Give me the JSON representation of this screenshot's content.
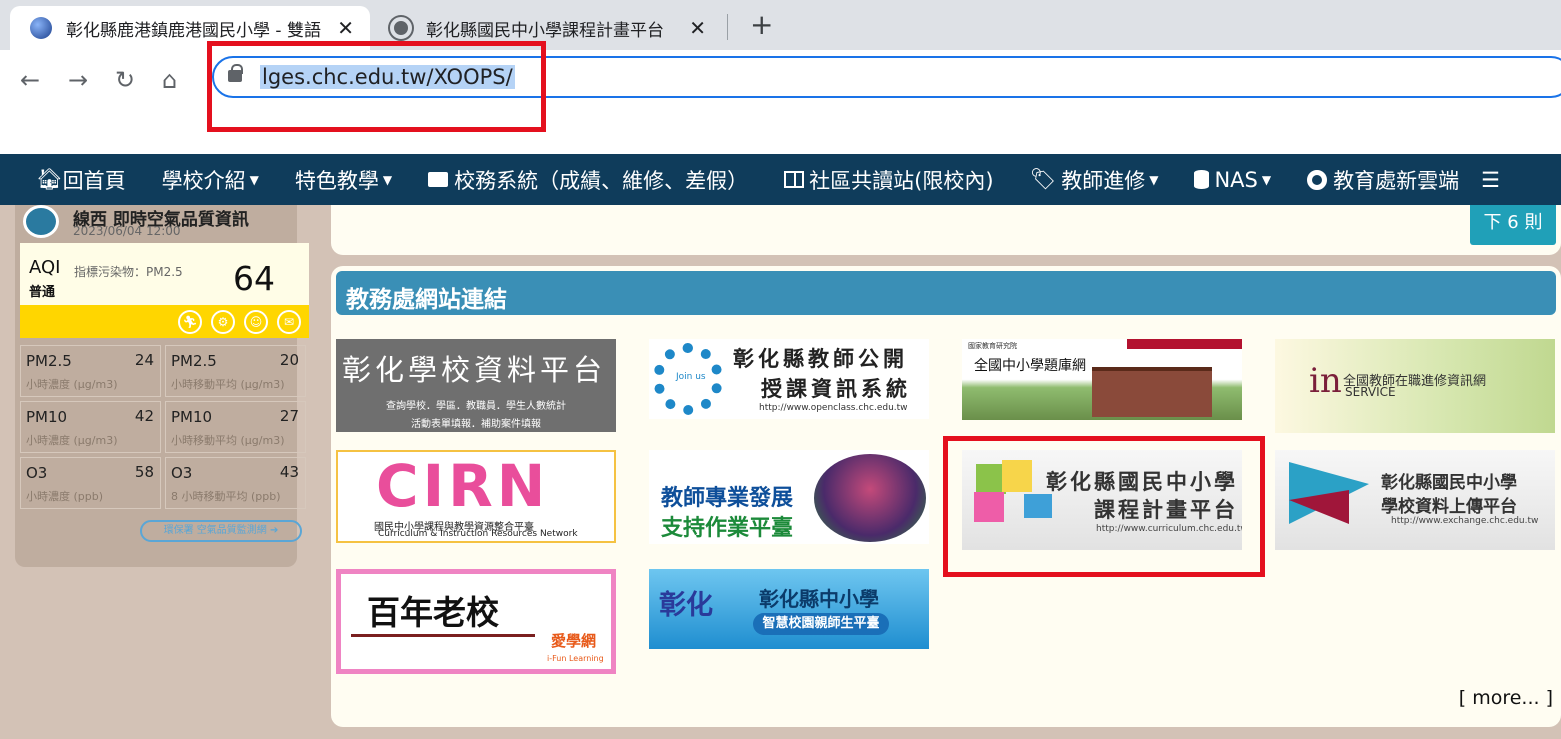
{
  "browser": {
    "tabs": [
      {
        "title": "彰化縣鹿港鎮鹿港國民小學 - 雙語",
        "close": "✕"
      },
      {
        "title": "彰化縣國民中小學課程計畫平台",
        "close": "✕"
      }
    ],
    "new_tab": "+",
    "url": "lges.chc.edu.tw/XOOPS/"
  },
  "nav": {
    "items": [
      {
        "icon": "home-icon",
        "label": "回首頁",
        "caret": false
      },
      {
        "icon": "",
        "label": "學校介紹",
        "caret": true
      },
      {
        "icon": "",
        "label": "特色教學",
        "caret": true
      },
      {
        "icon": "briefcase-icon",
        "label": "校務系統（成績、維修、差假）",
        "caret": false
      },
      {
        "icon": "columns-icon",
        "label": "社區共讀站(限校內)",
        "caret": false
      },
      {
        "icon": "tags-icon",
        "label": "教師進修",
        "caret": true
      },
      {
        "icon": "database-icon",
        "label": "NAS",
        "caret": true
      },
      {
        "icon": "lifebuoy-icon",
        "label": "教育處新雲端",
        "caret": false
      }
    ]
  },
  "air": {
    "title": "線西 即時空氣品質資訊",
    "date": "2023/06/04 12:00",
    "aqi_label": "AQI",
    "status": "普通",
    "pollutant": "指標污染物：PM2.5",
    "aqi_value": "64",
    "cells": [
      {
        "name": "PM2.5",
        "value": "24",
        "sub": "小時濃度 (μg/m3)"
      },
      {
        "name": "PM2.5",
        "value": "20",
        "sub": "小時移動平均 (μg/m3)"
      },
      {
        "name": "PM10",
        "value": "42",
        "sub": "小時濃度 (μg/m3)"
      },
      {
        "name": "PM10",
        "value": "27",
        "sub": "小時移動平均 (μg/m3)"
      },
      {
        "name": "O3",
        "value": "58",
        "sub": "小時濃度 (ppb)"
      },
      {
        "name": "O3",
        "value": "43",
        "sub": "8 小時移動平均 (ppb)"
      }
    ],
    "link": "環保署 空氣品質監測網 ➔"
  },
  "top_button": "下 6 則",
  "panel": {
    "title": "教務處網站連結",
    "more": "[ more... ]",
    "banners": [
      {
        "l1": "彰化學校資料平台",
        "l2": "查詢學校．學區．教職員．學生人數統計",
        "l3": "活動表單填報．補助案件填報"
      },
      {
        "l1": "彰化縣教師公開",
        "l2": "授課資訊系統",
        "l3": "http://www.openclass.chc.edu.tw",
        "logo": "Join us"
      },
      {
        "l1": "全國中小學題庫網",
        "l2": "國家教育研究院"
      },
      {
        "l1": "全國教師在職進修資訊網",
        "l2": "in",
        "l3": "SERVICE"
      },
      {
        "l1": "CIRN",
        "l2": "國民中小學課程與教學資源整合平臺",
        "l3": "Curriculum & Instruction Resources Network"
      },
      {
        "l1": "教師專業發展",
        "l2": "支持作業平臺"
      },
      {
        "l1": "彰化縣國民中小學",
        "l2": "課程計畫平台",
        "l3": "http://www.curriculum.chc.edu.tw"
      },
      {
        "l1": "彰化縣國民中小學",
        "l2": "學校資料上傳平台",
        "l3": "http://www.exchange.chc.edu.tw"
      },
      {
        "l1": "百年老校",
        "l2": "愛學網",
        "l3": "i-Fun Learning"
      },
      {
        "l1": "彰化縣中小學",
        "l2": "智慧校園親師生平臺",
        "l3": "彰化"
      }
    ]
  }
}
